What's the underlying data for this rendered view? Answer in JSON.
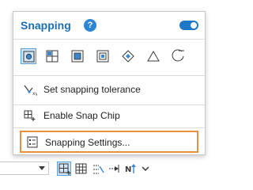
{
  "popup": {
    "title": "Snapping",
    "help_glyph": "?",
    "toggle_state": "on",
    "snap_types": [
      {
        "icon": "point-snap-icon",
        "active": true
      },
      {
        "icon": "end-snap-icon",
        "active": false
      },
      {
        "icon": "vertex-snap-icon",
        "active": false
      },
      {
        "icon": "edge-snap-icon",
        "active": false
      },
      {
        "icon": "intersection-snap-icon",
        "active": false
      },
      {
        "icon": "midpoint-snap-icon",
        "active": false
      },
      {
        "icon": "tangent-snap-icon",
        "active": false
      }
    ],
    "menu": {
      "tolerance_label": "Set snapping tolerance",
      "chip_label": "Enable Snap Chip",
      "settings_label": "Snapping Settings..."
    },
    "highlight_color": "#e8913a",
    "accent_color": "#1c6fb5"
  },
  "toolbar": {
    "buttons": [
      {
        "icon": "snapping-icon",
        "active": true
      },
      {
        "icon": "grid-icon",
        "active": false
      },
      {
        "icon": "constraints-icon",
        "active": false
      },
      {
        "icon": "correction-icon",
        "active": false
      },
      {
        "icon": "north-arrow-icon",
        "active": false
      },
      {
        "icon": "dropdown-chevron-icon",
        "active": false
      }
    ]
  }
}
